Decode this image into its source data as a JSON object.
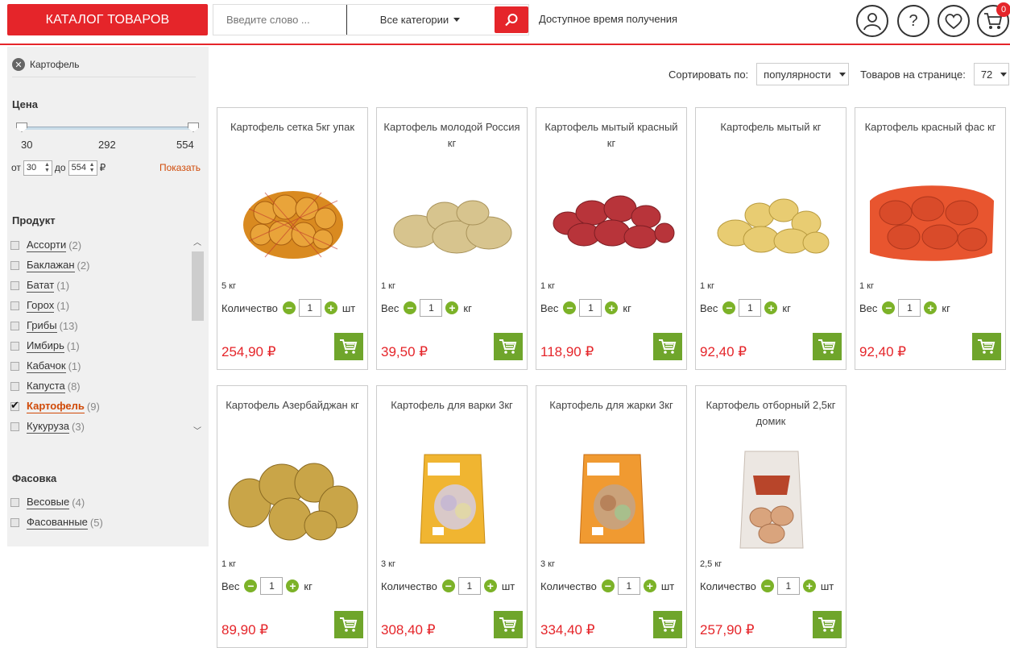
{
  "header": {
    "catalog_label": "КАТАЛОГ ТОВАРОВ",
    "search_placeholder": "Введите слово ...",
    "category_select": "Все категории",
    "delivery_label": "Доступное время получения",
    "cart_count": "0"
  },
  "sidebar": {
    "active_filter": "Картофель",
    "price": {
      "title": "Цена",
      "min": "30",
      "mid": "292",
      "max": "554",
      "from_label": "от",
      "to_label": "до",
      "from_value": "30",
      "to_value": "554",
      "currency": "₽",
      "apply_label": "Показать"
    },
    "product_title": "Продукт",
    "products": [
      {
        "label": "Ассорти",
        "count": "(2)"
      },
      {
        "label": "Баклажан",
        "count": "(2)"
      },
      {
        "label": "Батат",
        "count": "(1)"
      },
      {
        "label": "Горох",
        "count": "(1)"
      },
      {
        "label": "Грибы",
        "count": "(13)"
      },
      {
        "label": "Имбирь",
        "count": "(1)"
      },
      {
        "label": "Кабачок",
        "count": "(1)"
      },
      {
        "label": "Капуста",
        "count": "(8)"
      },
      {
        "label": "Картофель",
        "count": "(9)"
      },
      {
        "label": "Кукуруза",
        "count": "(3)"
      }
    ],
    "packing_title": "Фасовка",
    "packing": [
      {
        "label": "Весовые",
        "count": "(4)"
      },
      {
        "label": "Фасованные",
        "count": "(5)"
      }
    ]
  },
  "sortbar": {
    "sort_label": "Сортировать по:",
    "sort_value": "популярности",
    "per_page_label": "Товаров на странице:",
    "per_page_value": "72"
  },
  "products": [
    {
      "title": "Картофель сетка 5кг упак",
      "weight": "5 кг",
      "qty_label": "Количество",
      "qty": "1",
      "unit": "шт",
      "price": "254,90 ₽"
    },
    {
      "title": "Картофель молодой Россия кг",
      "weight": "1 кг",
      "qty_label": "Вес",
      "qty": "1",
      "unit": "кг",
      "price": "39,50 ₽"
    },
    {
      "title": "Картофель мытый красный кг",
      "weight": "1 кг",
      "qty_label": "Вес",
      "qty": "1",
      "unit": "кг",
      "price": "118,90 ₽"
    },
    {
      "title": "Картофель мытый кг",
      "weight": "1 кг",
      "qty_label": "Вес",
      "qty": "1",
      "unit": "кг",
      "price": "92,40 ₽"
    },
    {
      "title": "Картофель красный фас кг",
      "weight": "1 кг",
      "qty_label": "Вес",
      "qty": "1",
      "unit": "кг",
      "price": "92,40 ₽"
    },
    {
      "title": "Картофель Азербайджан кг",
      "weight": "1 кг",
      "qty_label": "Вес",
      "qty": "1",
      "unit": "кг",
      "price": "89,90 ₽"
    },
    {
      "title": "Картофель для варки 3кг",
      "weight": "3 кг",
      "qty_label": "Количество",
      "qty": "1",
      "unit": "шт",
      "price": "308,40 ₽"
    },
    {
      "title": "Картофель для жарки 3кг",
      "weight": "3 кг",
      "qty_label": "Количество",
      "qty": "1",
      "unit": "шт",
      "price": "334,40 ₽"
    },
    {
      "title": "Картофель отборный 2,5кг домик",
      "weight": "2,5 кг",
      "qty_label": "Количество",
      "qty": "1",
      "unit": "шт",
      "price": "257,90 ₽"
    }
  ]
}
